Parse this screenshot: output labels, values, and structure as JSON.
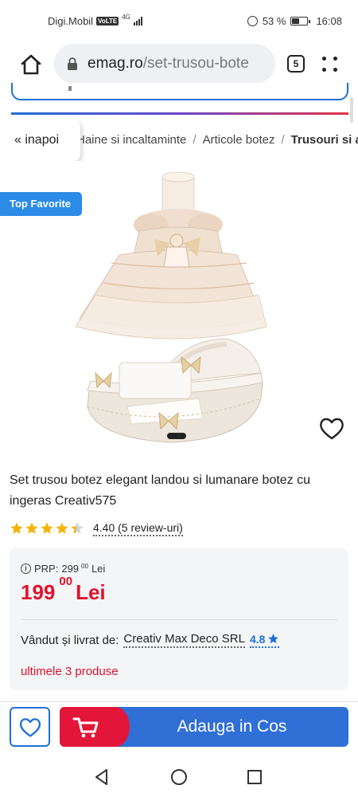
{
  "status_bar": {
    "carrier": "Digi.Mobil",
    "volte": "VoLTE",
    "network": "4G",
    "battery": "53 %",
    "time": "16:08"
  },
  "browser": {
    "url_domain": "emag.ro",
    "url_path": "/set-trusou-bote",
    "tab_count": "5"
  },
  "breadcrumb": {
    "back_label": "« inapoi",
    "items": [
      "Haine si incaltaminte",
      "Articole botez",
      "Trusouri si accesorii botez"
    ]
  },
  "product": {
    "badge": "Top Favorite",
    "title": "Set trusou botez elegant landou si lumanare botez cu ingeras Creativ575",
    "rating_value": 4.4,
    "rating_text": "4.40 (5 review-uri)",
    "prp_label": "PRP:",
    "prp_int": "299",
    "prp_dec": "00",
    "prp_currency": "Lei",
    "price_int": "199",
    "price_dec": "00",
    "price_currency": "Lei",
    "seller_label": "Vândut și livrat de:",
    "seller_name": "Creativ Max Deco SRL",
    "seller_rating": "4.8",
    "stock_text": "ultimele 3 produse"
  },
  "actions": {
    "add_to_cart_label": "Adauga in Cos"
  },
  "colors": {
    "accent_blue": "#2f6fd6",
    "price_red": "#e1122b",
    "cart_red": "#e3163a",
    "star_gold": "#f4b400",
    "badge_blue": "#2b8be6"
  },
  "icons": [
    "home-icon",
    "lock-icon",
    "tabs-icon",
    "more-vert-icon",
    "heart-icon",
    "star-icon",
    "info-icon",
    "cart-icon",
    "back-nav-icon",
    "home-nav-icon",
    "recents-nav-icon"
  ]
}
